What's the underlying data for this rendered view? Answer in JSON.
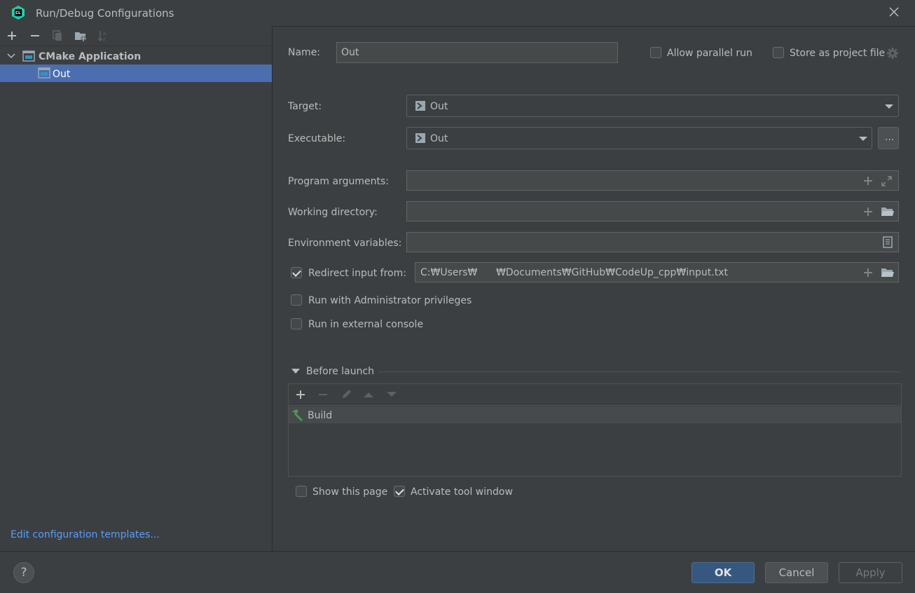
{
  "window": {
    "title": "Run/Debug Configurations"
  },
  "toolbar": {
    "add": "+",
    "remove": "−"
  },
  "tree": {
    "root_label": "CMake Application",
    "child_label": "Out"
  },
  "left_footer": {
    "edit_templates": "Edit configuration templates..."
  },
  "form": {
    "name_label": "Name:",
    "name_value": "Out",
    "allow_parallel_label": "Allow parallel run",
    "store_project_label": "Store as project file",
    "target_label": "Target:",
    "target_value": "Out",
    "executable_label": "Executable:",
    "executable_value": "Out",
    "browse_label": "...",
    "program_args_label": "Program arguments:",
    "working_dir_label": "Working directory:",
    "env_vars_label": "Environment variables:",
    "redirect_label": "Redirect input from:",
    "redirect_value": "C:₩Users₩      ₩Documents₩GitHub₩CodeUp_cpp₩input.txt",
    "admin_label": "Run with Administrator privileges",
    "external_console_label": "Run in external console"
  },
  "before_launch": {
    "title": "Before launch",
    "items": [
      "Build"
    ],
    "show_page_label": "Show this page",
    "activate_tool_label": "Activate tool window"
  },
  "footer": {
    "help": "?",
    "ok": "OK",
    "cancel": "Cancel",
    "apply": "Apply"
  },
  "colors": {
    "background": "#3c3f41",
    "selection": "#4b6eaf",
    "link": "#589df6",
    "primary_button": "#365880",
    "build_icon": "#499c54"
  }
}
